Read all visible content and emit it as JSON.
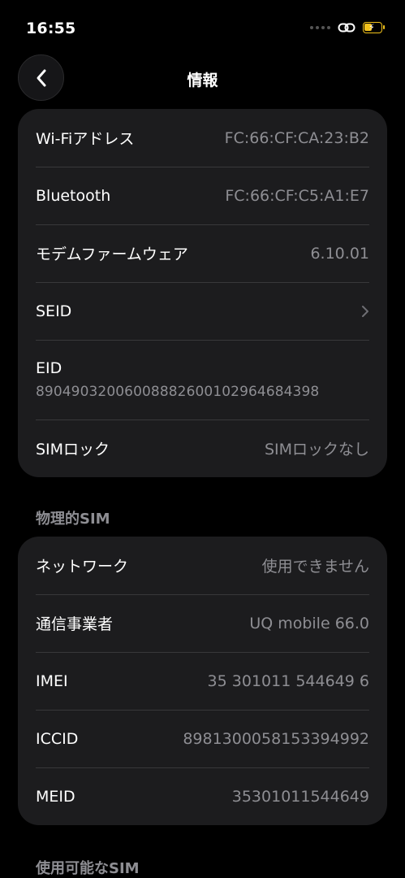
{
  "status_bar": {
    "time": "16:55"
  },
  "header": {
    "title": "情報"
  },
  "device_info": {
    "rows": [
      {
        "label": "Wi-Fiアドレス",
        "value": "FC:66:CF:CA:23:B2"
      },
      {
        "label": "Bluetooth",
        "value": "FC:66:CF:C5:A1:E7"
      },
      {
        "label": "モデムファームウェア",
        "value": "6.10.01"
      },
      {
        "label": "SEID",
        "icon": "chevron-right-icon"
      },
      {
        "label": "EID",
        "value": "89049032006008882600102964684398"
      },
      {
        "label": "SIMロック",
        "value": "SIMロックなし"
      }
    ]
  },
  "physical_sim": {
    "header": "物理的SIM",
    "rows": [
      {
        "label": "ネットワーク",
        "value": "使用できません"
      },
      {
        "label": "通信事業者",
        "value": "UQ mobile 66.0"
      },
      {
        "label": "IMEI",
        "value": "35 301011 544649 6"
      },
      {
        "label": "ICCID",
        "value": "8981300058153394992"
      },
      {
        "label": "MEID",
        "value": "35301011544649"
      }
    ]
  },
  "available_sim": {
    "header": "使用可能なSIM"
  },
  "colors": {
    "background": "#000000",
    "card": "#1c1c1e",
    "secondary_text": "#8e8e93",
    "separator": "#38383a",
    "battery_charging": "#f2c21b"
  }
}
